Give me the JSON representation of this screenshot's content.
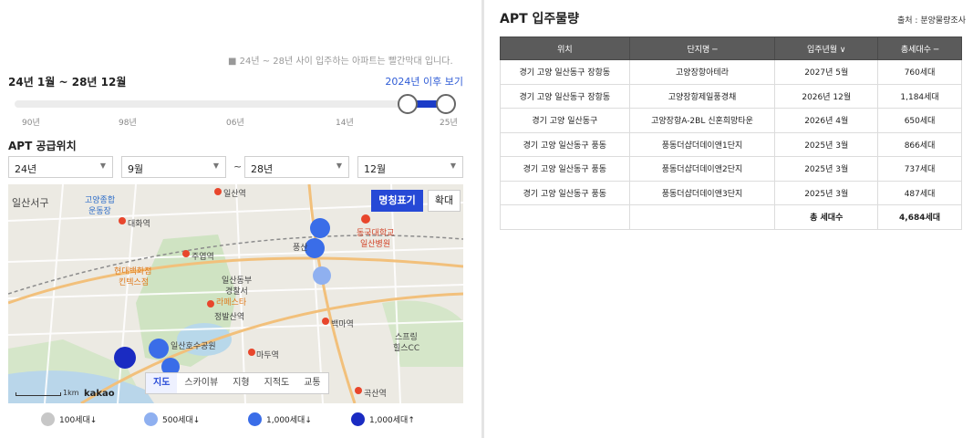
{
  "left": {
    "note": "■ 24년 ~ 28년 사이 입주하는 아파트는 빨간막대 입니다.",
    "range_text": "24년 1월 ~ 28년 12월",
    "after_link": "2024년 이후 보기",
    "slider_ticks": [
      "90년",
      "98년",
      "06년",
      "14년",
      "25년"
    ],
    "supply_title": "APT 공급위치",
    "selects": {
      "from_year": "24년",
      "from_month": "9월",
      "tilde": "~",
      "to_year": "28년",
      "to_month": "12월"
    },
    "map": {
      "labels": {
        "l1": "일산서구",
        "l2": "고양종합",
        "l3": "운동장",
        "l4": "대화역",
        "l5": "일산역",
        "l6": "주엽역",
        "l7": "동국대학교",
        "l8": "일산병원",
        "l9": "현대백화점",
        "l10": "킨텍스점",
        "l11": "일산동부",
        "l12": "경찰서",
        "l13": "라페스타",
        "l14": "정발산역",
        "l15": "백마역",
        "l16": "스프링",
        "l17": "힐스CC",
        "l18": "일산호수공원",
        "l19": "마두역",
        "l20": "곡산역",
        "l21": "풍산"
      },
      "btn_label": "명칭표기",
      "btn_zoom": "확대",
      "map_types": [
        "지도",
        "스카이뷰",
        "지형",
        "지적도",
        "교통"
      ],
      "scale": "1km",
      "brand": "kakao"
    },
    "legend": [
      {
        "label": "100세대↓",
        "color": "#c7c7c7"
      },
      {
        "label": "500세대↓",
        "color": "#8fb0f0"
      },
      {
        "label": "1,000세대↓",
        "color": "#3a6de8"
      },
      {
        "label": "1,000세대↑",
        "color": "#1a2bc2"
      }
    ]
  },
  "right": {
    "title": "APT 입주물량",
    "source": "출처 : 분양물량조사",
    "headers": [
      "위치",
      "단지명 ─",
      "입주년월 ∨",
      "총세대수 ─"
    ],
    "rows": [
      [
        "경기 고양 일산동구 장항동",
        "고양장항아테라",
        "2027년 5월",
        "760세대"
      ],
      [
        "경기 고양 일산동구 장항동",
        "고양장항제일풍경채",
        "2026년 12월",
        "1,184세대"
      ],
      [
        "경기 고양 일산동구",
        "고양장항A-2BL 신혼희망타운",
        "2026년 4월",
        "650세대"
      ],
      [
        "경기 고양 일산동구 풍동",
        "풍동더샵더데이앤1단지",
        "2025년 3월",
        "866세대"
      ],
      [
        "경기 고양 일산동구 풍동",
        "풍동더샵더데이앤2단지",
        "2025년 3월",
        "737세대"
      ],
      [
        "경기 고양 일산동구 풍동",
        "풍동더샵더데이앤3단지",
        "2025년 3월",
        "487세대"
      ]
    ],
    "total_label": "총 세대수",
    "total_value": "4,684세대"
  },
  "colors": {
    "accent": "#2649d6",
    "table_header": "#5b5b5b"
  }
}
